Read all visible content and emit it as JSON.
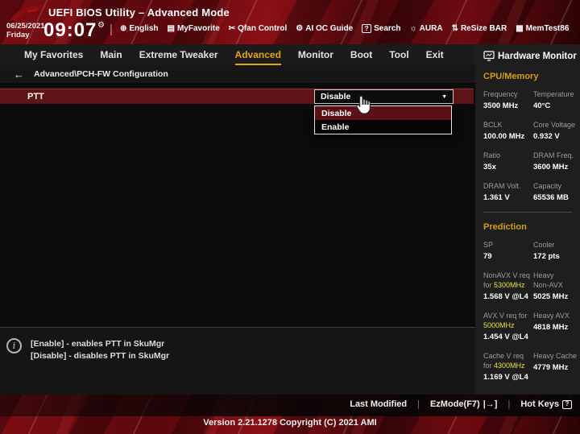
{
  "colors": {
    "accent_gold": "#e3a60b",
    "highlight_yellow": "#e6e23a",
    "setting_row_red": "#5e1316",
    "banner_red": "#7e0d13",
    "panel_bg": "#1e1e1e"
  },
  "titlebar": {
    "title": "UEFI BIOS Utility – Advanced Mode",
    "date": "06/25/2021",
    "day": "Friday",
    "time": "09:07"
  },
  "icons": {
    "english": "⊕",
    "myfavorite": "▤",
    "qfan": "✂",
    "ai_oc": "⚙",
    "search_q": "?",
    "aura": "☼",
    "resize_bar": "⇅",
    "memtest": "▦",
    "time_settings": "⚙",
    "divider": "|",
    "back_arrow": "←",
    "dropdown_arrow": "▼",
    "info": "i",
    "hotkeys_q": "?",
    "ezmode_glyph": "|→]"
  },
  "quickbar": {
    "items": [
      {
        "label": "English"
      },
      {
        "label": "MyFavorite"
      },
      {
        "label": "Qfan Control"
      },
      {
        "label": "AI OC Guide"
      },
      {
        "label": "Search"
      },
      {
        "label": "AURA"
      },
      {
        "label": "ReSize BAR"
      },
      {
        "label": "MemTest86"
      }
    ]
  },
  "tabs": {
    "items": [
      "My Favorites",
      "Main",
      "Extreme Tweaker",
      "Advanced",
      "Monitor",
      "Boot",
      "Tool",
      "Exit"
    ],
    "active": "Advanced"
  },
  "breadcrumb": {
    "text": "Advanced\\PCH-FW Configuration"
  },
  "main": {
    "setting_label": "PTT",
    "setting_value": "Disable",
    "dropdown_selected": "Disable",
    "dropdown_options": [
      "Disable",
      "Enable"
    ]
  },
  "help": {
    "line1": "[Enable] - enables PTT in SkuMgr",
    "line2": "[Disable] - disables PTT in SkuMgr"
  },
  "hardware_monitor": {
    "title": "Hardware Monitor",
    "cpu_memory": {
      "title": "CPU/Memory",
      "rows": [
        {
          "l_label": "Frequency",
          "l_value": "3500 MHz",
          "r_label": "Temperature",
          "r_value": "40°C"
        },
        {
          "l_label": "BCLK",
          "l_value": "100.00 MHz",
          "r_label": "Core Voltage",
          "r_value": "0.932 V"
        },
        {
          "l_label": "Ratio",
          "l_value": "35x",
          "r_label": "DRAM Freq.",
          "r_value": "3600 MHz"
        },
        {
          "l_label": "DRAM Volt.",
          "l_value": "1.361 V",
          "r_label": "Capacity",
          "r_value": "65536 MB"
        }
      ]
    },
    "prediction": {
      "title": "Prediction",
      "rows": [
        {
          "l_label1": "SP",
          "l_value": "79",
          "r_label1": "Cooler",
          "r_value": "172 pts"
        },
        {
          "l_label1": "NonAVX V req",
          "l_label2": "for ",
          "l_label2_hl": "5300MHz",
          "l_value": "1.568 V @L4",
          "r_label1": "Heavy",
          "r_label2": "Non-AVX",
          "r_value": "5025 MHz"
        },
        {
          "l_label1": "AVX V req for",
          "l_label2_hl": "5000MHz",
          "l_value": "1.454 V @L4",
          "r_label1": "Heavy AVX",
          "r_value": "4818 MHz"
        },
        {
          "l_label1": "Cache V req",
          "l_label2": "for ",
          "l_label2_hl": "4300MHz",
          "l_value": "1.169 V @L4",
          "r_label1": "Heavy Cache",
          "r_value": "4779 MHz"
        }
      ]
    }
  },
  "footer": {
    "last_modified": "Last Modified",
    "ezmode": "EzMode(F7)",
    "hotkeys": "Hot Keys",
    "version": "Version 2.21.1278 Copyright (C) 2021 AMI"
  }
}
